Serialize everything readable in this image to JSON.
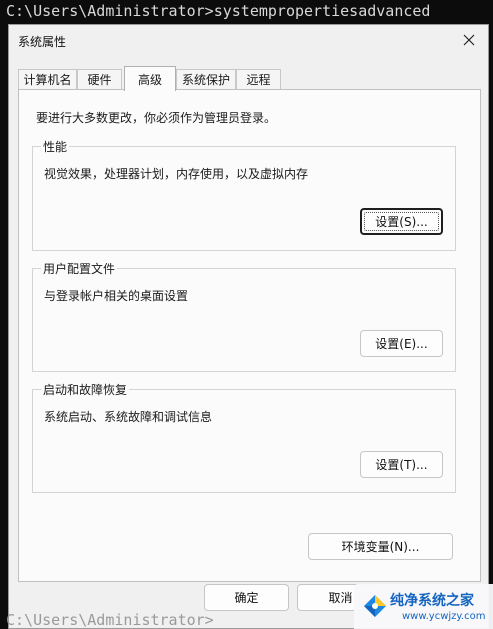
{
  "console": {
    "prompt_line": "C:\\Users\\Administrator>systempropertiesadvanced",
    "bottom_line": "C:\\Users\\Administrator>"
  },
  "dialog": {
    "title": "系统属性",
    "tabs": [
      {
        "label": "计算机名",
        "active": false
      },
      {
        "label": "硬件",
        "active": false
      },
      {
        "label": "高级",
        "active": true
      },
      {
        "label": "系统保护",
        "active": false
      },
      {
        "label": "远程",
        "active": false
      }
    ],
    "admin_notice": "要进行大多数更改，你必须作为管理员登录。",
    "performance": {
      "title": "性能",
      "description": "视觉效果，处理器计划，内存使用，以及虚拟内存",
      "button_label": "设置(S)..."
    },
    "user_profiles": {
      "title": "用户配置文件",
      "description": "与登录帐户相关的桌面设置",
      "button_label": "设置(E)..."
    },
    "startup_recovery": {
      "title": "启动和故障恢复",
      "description": "系统启动、系统故障和调试信息",
      "button_label": "设置(T)..."
    },
    "env_vars_button": "环境变量(N)...",
    "ok_button": "确定",
    "cancel_button": "取消"
  },
  "watermark": {
    "title": "纯净系统之家",
    "url": "www.ycwjzy.com",
    "colors": {
      "brand": "#1565c0"
    }
  },
  "colors": {
    "console_bg": "#0c0c0c",
    "dialog_bg": "#f0f0f0",
    "panel_bg": "#fbfbfb"
  }
}
